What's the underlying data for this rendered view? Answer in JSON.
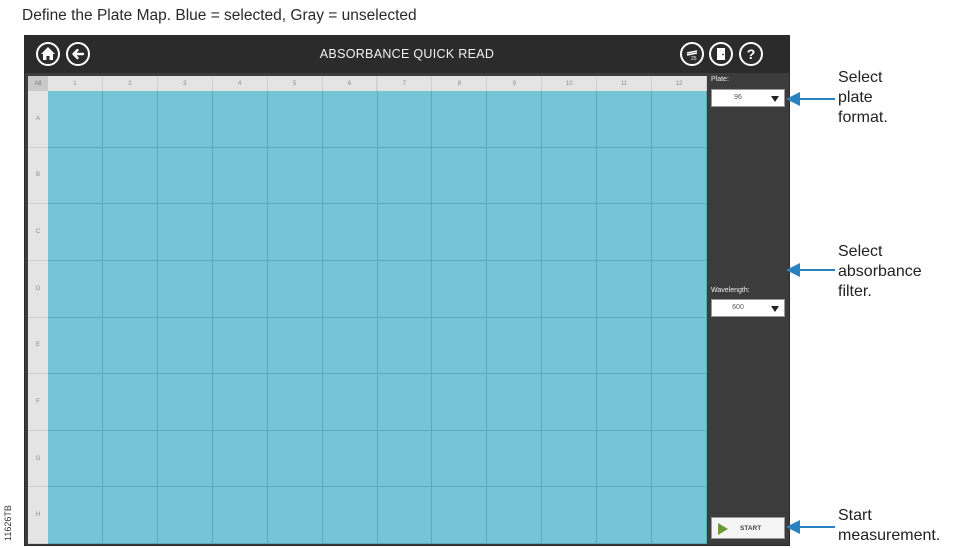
{
  "caption": "Define the Plate Map. Blue = selected, Gray = unselected",
  "side_code": "11626TB",
  "app": {
    "title": "ABSORBANCE QUICK READ",
    "toolbar": {
      "home_icon": "home-icon",
      "back_icon": "back-arrow-icon",
      "tools_icon": "calibration-icon",
      "exit_icon": "door-exit-icon",
      "help_label": "?"
    }
  },
  "plate_map": {
    "corner_label": "All",
    "columns": [
      "1",
      "2",
      "3",
      "4",
      "5",
      "6",
      "7",
      "8",
      "9",
      "10",
      "11",
      "12"
    ],
    "rows": [
      "A",
      "B",
      "C",
      "D",
      "E",
      "F",
      "G",
      "H"
    ],
    "selected_color": "#76c5d6"
  },
  "panel": {
    "plate_label": "Plate:",
    "plate_value": "96",
    "wavelength_label": "Wavelength:",
    "wavelength_value": "600",
    "start_label": "START"
  },
  "callouts": {
    "plate": [
      "Select",
      "plate",
      "format."
    ],
    "wavelength": [
      "Select",
      "absorbance",
      "filter."
    ],
    "start": [
      "Start",
      "measurement."
    ]
  },
  "colors": {
    "arrow": "#2a82c1",
    "titlebar": "#2b2b2b",
    "panel": "#3c3c3c",
    "start_icon": "#6a9a3a"
  }
}
